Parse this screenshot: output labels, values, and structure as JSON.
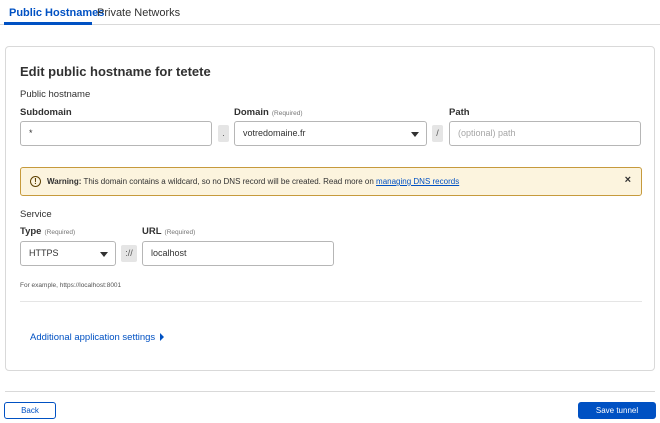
{
  "tabs": [
    {
      "label": "Public Hostnames",
      "active": true
    },
    {
      "label": "Private Networks",
      "active": false
    }
  ],
  "form": {
    "title": "Edit public hostname for tetete",
    "public_hostname_label": "Public hostname",
    "subdomain": {
      "label": "Subdomain",
      "value": "*"
    },
    "dot_separator": ".",
    "domain": {
      "label": "Domain",
      "required": "(Required)",
      "value": "votredomaine.fr"
    },
    "slash_separator": "/",
    "path": {
      "label": "Path",
      "placeholder": "(optional) path"
    }
  },
  "warning": {
    "icon": "exclamation-circle-icon",
    "label": "Warning:",
    "message": " This domain contains a wildcard, so no DNS record will be created. Read more on ",
    "link": "managing DNS records",
    "close": "×"
  },
  "service": {
    "label": "Service",
    "type": {
      "label": "Type",
      "required": "(Required)",
      "value": "HTTPS"
    },
    "scheme_separator": "://",
    "url": {
      "label": "URL",
      "required": "(Required)",
      "value": "localhost"
    },
    "hint": "For example, https://localhost:8001"
  },
  "additional": {
    "label": "Additional application settings"
  },
  "footer": {
    "back": "Back",
    "save": "Save tunnel"
  },
  "colors": {
    "accent": "#0051c3",
    "warning_bg": "#fcf4de",
    "warning_border": "#c69a3c"
  }
}
